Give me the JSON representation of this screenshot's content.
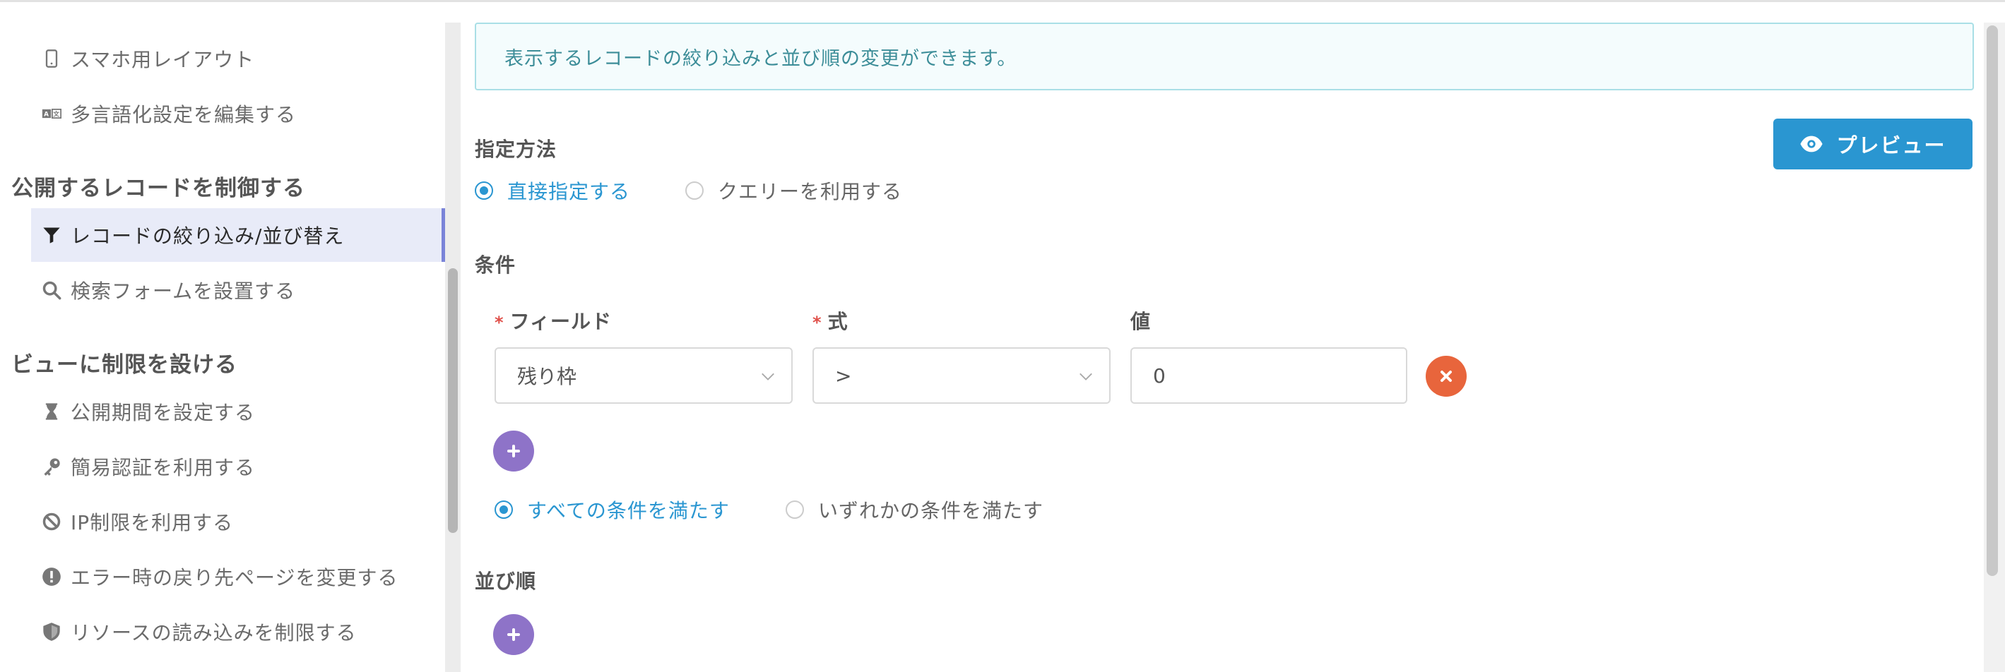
{
  "sidebar": {
    "items_top": [
      {
        "label": "スマホ用レイアウト",
        "icon": "smartphone-icon"
      },
      {
        "label": "多言語化設定を編集する",
        "icon": "translate-icon"
      }
    ],
    "section1": {
      "heading": "公開するレコードを制御する",
      "items": [
        {
          "label": "レコードの絞り込み/並び替え",
          "icon": "filter-icon",
          "active": true
        },
        {
          "label": "検索フォームを設置する",
          "icon": "search-icon"
        }
      ]
    },
    "section2": {
      "heading": "ビューに制限を設ける",
      "items": [
        {
          "label": "公開期間を設定する",
          "icon": "hourglass-icon"
        },
        {
          "label": "簡易認証を利用する",
          "icon": "key-icon"
        },
        {
          "label": "IP制限を利用する",
          "icon": "ban-icon"
        },
        {
          "label": "エラー時の戻り先ページを変更する",
          "icon": "alert-icon"
        },
        {
          "label": "リソースの読み込みを制限する",
          "icon": "shield-icon"
        }
      ]
    }
  },
  "main": {
    "info": "表示するレコードの絞り込みと並び順の変更ができます。",
    "method": {
      "label": "指定方法",
      "options": [
        "直接指定する",
        "クエリーを利用する"
      ],
      "selected": 0
    },
    "preview_button": "プレビュー",
    "conditions": {
      "label": "条件",
      "field_header": "フィールド",
      "op_header": "式",
      "value_header": "値",
      "required_mark": "*",
      "rows": [
        {
          "field": "残り枠",
          "op": ">",
          "value": "0"
        }
      ],
      "match_options": [
        "すべての条件を満たす",
        "いずれかの条件を満たす"
      ],
      "match_selected": 0
    },
    "sort": {
      "label": "並び順"
    }
  },
  "colors": {
    "accent": "#2a96d1",
    "plus": "#8e73c8",
    "remove": "#e8653c",
    "active_bg": "#e8ebf8"
  }
}
